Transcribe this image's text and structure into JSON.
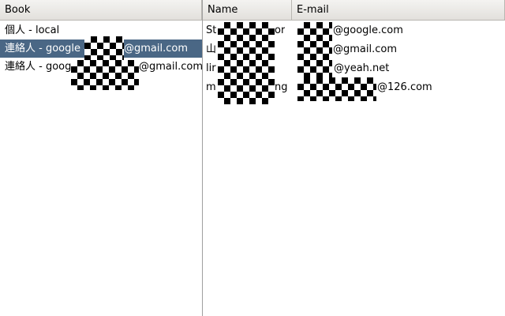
{
  "books": {
    "header": "Book",
    "items": [
      {
        "prefix": "個人 - local",
        "suffix": ""
      },
      {
        "prefix": "連絡人 - google - ",
        "suffix": "@gmail.com",
        "selected": true
      },
      {
        "prefix": "連絡人 - googl",
        "suffix": "@gmail.com"
      }
    ]
  },
  "contacts": {
    "headers": {
      "name": "Name",
      "email": "E-mail"
    },
    "rows": [
      {
        "name_start": "St",
        "name_end": "or",
        "email": "@google.com"
      },
      {
        "name_start": "山",
        "name_end": "",
        "email": "@gmail.com"
      },
      {
        "name_start": "lir",
        "name_end": "",
        "email": "@yeah.net"
      },
      {
        "name_start": "m",
        "name_end": "ng",
        "email": "@126.com"
      }
    ]
  },
  "colors": {
    "selection": "#4a6785",
    "header": "#e8e6e2"
  }
}
